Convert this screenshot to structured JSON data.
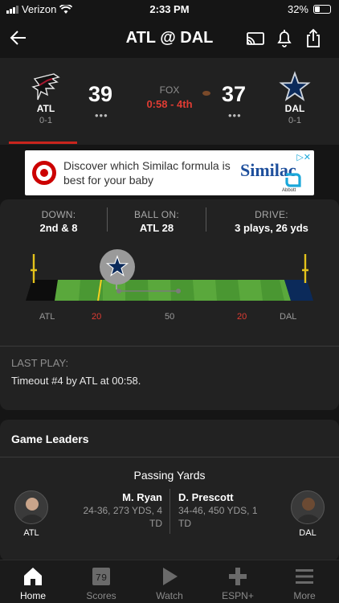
{
  "status_bar": {
    "carrier": "Verizon",
    "time": "2:33 PM",
    "battery": "32%"
  },
  "header": {
    "title": "ATL @ DAL"
  },
  "game": {
    "away": {
      "abbr": "ATL",
      "record": "0-1",
      "score": "39",
      "timeouts": "•••"
    },
    "home": {
      "abbr": "DAL",
      "record": "0-1",
      "score": "37",
      "timeouts": "•••"
    },
    "network": "FOX",
    "clock": "0:58 - 4th"
  },
  "ad": {
    "text": "Discover which Similac formula is best for your baby",
    "brand": "Similac",
    "sub_brand": "Abbott"
  },
  "drive": {
    "down_label": "DOWN:",
    "down_value": "2nd & 8",
    "ball_label": "BALL ON:",
    "ball_value": "ATL 28",
    "drive_label": "DRIVE:",
    "drive_value": "3 plays, 26 yds",
    "field_labels": {
      "left_team": "ATL",
      "left_20": "20",
      "mid": "50",
      "right_20": "20",
      "right_team": "DAL"
    },
    "ball_position_fraction": 0.32,
    "last_play_label": "LAST PLAY:",
    "last_play_text": "Timeout #4 by ATL at 00:58."
  },
  "leaders": {
    "title": "Game Leaders",
    "category": "Passing Yards",
    "away_player": {
      "name": "M. Ryan",
      "stats": "24-36, 273 YDS, 4 TD",
      "team": "ATL"
    },
    "home_player": {
      "name": "D. Prescott",
      "stats": "34-46, 450 YDS, 1 TD",
      "team": "DAL"
    }
  },
  "tabbar": {
    "items": [
      {
        "label": "Home",
        "icon": "home-icon"
      },
      {
        "label": "Scores",
        "icon": "scores-icon"
      },
      {
        "label": "Watch",
        "icon": "play-icon"
      },
      {
        "label": "ESPN+",
        "icon": "plus-icon"
      },
      {
        "label": "More",
        "icon": "menu-icon"
      }
    ]
  },
  "colors": {
    "accent_red": "#e03c33",
    "field_green": "#5aa83c",
    "dallas_navy": "#0b2a5a",
    "falcons_red": "#a71930"
  }
}
